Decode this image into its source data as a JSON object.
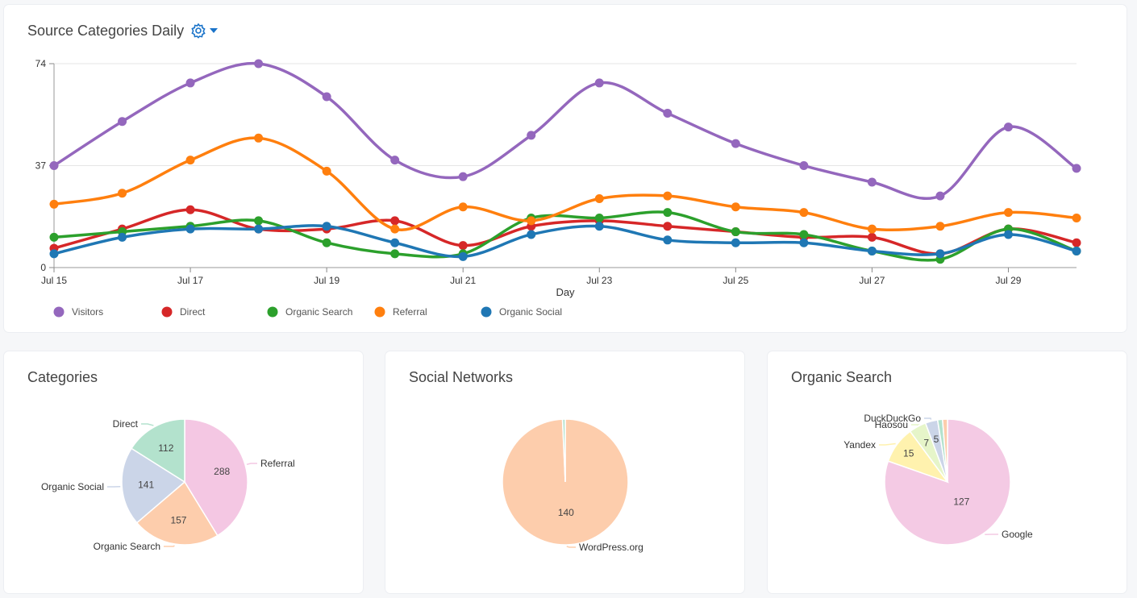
{
  "top_card": {
    "title": "Source Categories Daily",
    "settings_icon": "gear-icon"
  },
  "chart_data": [
    {
      "type": "line",
      "title": "Source Categories Daily",
      "xlabel": "Day",
      "ylabel": "",
      "ylim": [
        0,
        74
      ],
      "y_ticks": [
        0,
        37,
        74
      ],
      "x_tick_labels": [
        "Jul 15",
        "Jul 17",
        "Jul 19",
        "Jul 21",
        "Jul 23",
        "Jul 25",
        "Jul 27",
        "Jul 29"
      ],
      "x_tick_days": [
        15,
        17,
        19,
        21,
        23,
        25,
        27,
        29
      ],
      "x": [
        15,
        16,
        17,
        18,
        19,
        20,
        21,
        22,
        23,
        24,
        25,
        26,
        27,
        28,
        29,
        30
      ],
      "grid": true,
      "legend": "bottom-left",
      "series": [
        {
          "name": "Visitors",
          "color": "#9467bd",
          "values": [
            37,
            53,
            67,
            74,
            62,
            39,
            33,
            48,
            67,
            56,
            45,
            37,
            31,
            26,
            51,
            36
          ]
        },
        {
          "name": "Direct",
          "color": "#d62728",
          "values": [
            7,
            14,
            21,
            14,
            14,
            17,
            8,
            15,
            17,
            15,
            13,
            11,
            11,
            5,
            14,
            9
          ]
        },
        {
          "name": "Organic Search",
          "color": "#2ca02c",
          "values": [
            11,
            13,
            15,
            17,
            9,
            5,
            5,
            18,
            18,
            20,
            13,
            12,
            6,
            3,
            14,
            6
          ]
        },
        {
          "name": "Referral",
          "color": "#ff7f0e",
          "values": [
            23,
            27,
            39,
            47,
            35,
            14,
            22,
            17,
            25,
            26,
            22,
            20,
            14,
            15,
            20,
            18
          ]
        },
        {
          "name": "Organic Social",
          "color": "#1f77b4",
          "values": [
            5,
            11,
            14,
            14,
            15,
            9,
            4,
            12,
            15,
            10,
            9,
            9,
            6,
            5,
            12,
            6
          ]
        }
      ]
    },
    {
      "type": "pie",
      "title": "Categories",
      "slices": [
        {
          "label": "Referral",
          "value": 288,
          "color": "#f4c7e3"
        },
        {
          "label": "Organic Search",
          "value": 157,
          "color": "#fdcdac"
        },
        {
          "label": "Organic Social",
          "value": 141,
          "color": "#cbd5e8"
        },
        {
          "label": "Direct",
          "value": 112,
          "color": "#b3e2cd"
        }
      ]
    },
    {
      "type": "pie",
      "title": "Social Networks",
      "slices": [
        {
          "label": "WordPress.org",
          "value": 140,
          "color": "#fdcdac"
        },
        {
          "label": "",
          "value": 1,
          "color": "#b3e2cd"
        }
      ]
    },
    {
      "type": "pie",
      "title": "Organic Search",
      "slices": [
        {
          "label": "Google",
          "value": 127,
          "color": "#f4cae4"
        },
        {
          "label": "Yandex",
          "value": 15,
          "color": "#fff2ae"
        },
        {
          "label": "Haosou",
          "value": 7,
          "color": "#e6f5c9"
        },
        {
          "label": "DuckDuckGo",
          "value": 5,
          "color": "#cbd5e8"
        },
        {
          "label": "",
          "value": 2,
          "color": "#b3e2cd"
        },
        {
          "label": "",
          "value": 2,
          "color": "#fdcdac"
        }
      ]
    }
  ]
}
